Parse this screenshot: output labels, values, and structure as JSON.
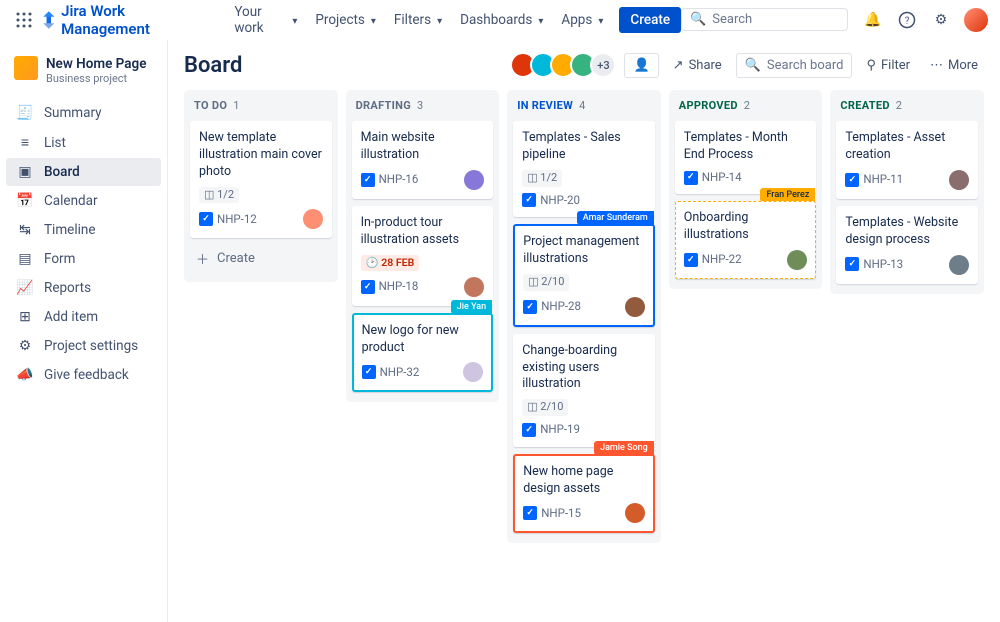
{
  "nav": {
    "product": "Jira Work Management",
    "items": [
      "Your work",
      "Projects",
      "Filters",
      "Dashboards",
      "Apps"
    ],
    "create": "Create",
    "search_placeholder": "Search"
  },
  "sidebar": {
    "project_name": "New Home Page",
    "project_type": "Business project",
    "items": [
      {
        "icon": "≣",
        "label": "Summary"
      },
      {
        "icon": "☰",
        "label": "List"
      },
      {
        "icon": "▦",
        "label": "Board",
        "active": true
      },
      {
        "icon": "▦",
        "label": "Calendar"
      },
      {
        "icon": "≡",
        "label": "Timeline"
      },
      {
        "icon": "☷",
        "label": "Form"
      },
      {
        "icon": "⬀",
        "label": "Reports"
      },
      {
        "icon": "⊕",
        "label": "Add item"
      },
      {
        "icon": "⚙",
        "label": "Project settings"
      },
      {
        "icon": "⟰",
        "label": "Give feedback"
      }
    ]
  },
  "header": {
    "title": "Board",
    "extra_count": "+3",
    "share": "Share",
    "search_board": "Search board",
    "filter": "Filter",
    "more": "More"
  },
  "columns": [
    {
      "title": "TO DO",
      "count": "1",
      "title_class": "",
      "cards": [
        {
          "title": "New template illustration main cover photo",
          "sub": "1/2",
          "key": "NHP-12",
          "avatar": "#ff8f73"
        }
      ],
      "create": "Create"
    },
    {
      "title": "DRAFTING",
      "count": "3",
      "title_class": "",
      "cards": [
        {
          "title": "Main website illustration",
          "key": "NHP-16",
          "avatar": "#8777D9"
        },
        {
          "title": "In-product tour illustration assets",
          "due": "28 FEB",
          "key": "NHP-18",
          "avatar": "#c2765d",
          "flag_bot": "Jie Yan",
          "flag_color": "teal"
        },
        {
          "title": "New logo for new product",
          "key": "NHP-32",
          "avatar": "#d0c5e0",
          "border": "teal"
        }
      ]
    },
    {
      "title": "IN REVIEW",
      "count": "4",
      "title_class": "blue",
      "cards": [
        {
          "title": "Templates - Sales pipeline",
          "sub": "1/2",
          "key": "NHP-20",
          "flag_bot": "Amar Sunderam",
          "flag_color": "blue"
        },
        {
          "title": "Project management illustrations",
          "sub": "2/10",
          "key": "NHP-28",
          "avatar": "#925b3e",
          "border": "blue"
        },
        {
          "title": "Change-boarding existing users illustration",
          "sub": "2/10",
          "key": "NHP-19",
          "flag_bot": "Jamie Song",
          "flag_color": "orange"
        },
        {
          "title": "New home page design assets",
          "key": "NHP-15",
          "avatar": "#d45c2b",
          "border": "orange"
        }
      ]
    },
    {
      "title": "APPROVED",
      "count": "2",
      "title_class": "teal",
      "cards": [
        {
          "title": "Templates - Month End Process",
          "key": "NHP-14",
          "flag_bot": "Fran Perez",
          "flag_color": "yellow"
        },
        {
          "title": "Onboarding illustrations",
          "key": "NHP-22",
          "avatar": "#6e8d59",
          "border": "yellow"
        }
      ]
    },
    {
      "title": "CREATED",
      "count": "2",
      "title_class": "green",
      "cards": [
        {
          "title": "Templates - Asset creation",
          "key": "NHP-11",
          "avatar": "#8a6d6d"
        },
        {
          "title": "Templates - Website design process",
          "key": "NHP-13",
          "avatar": "#6d7d8a"
        }
      ]
    }
  ]
}
